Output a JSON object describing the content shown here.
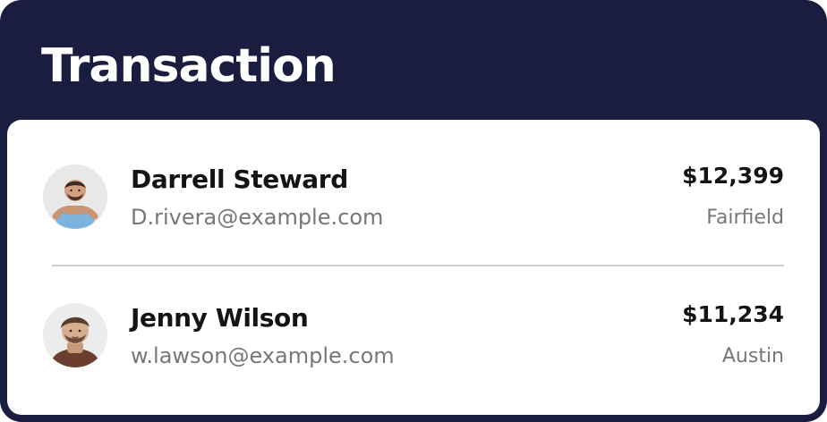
{
  "header": {
    "title": "Transaction"
  },
  "transactions": [
    {
      "name": "Darrell Steward",
      "email": "D.rivera@example.com",
      "amount": "$12,399",
      "location": "Fairfield",
      "avatar_icon": "person-blue-shirt-avatar"
    },
    {
      "name": "Jenny Wilson",
      "email": "w.lawson@example.com",
      "amount": "$11,234",
      "location": "Austin",
      "avatar_icon": "person-dark-shirt-avatar"
    }
  ],
  "colors": {
    "background": "#1a1d3f",
    "card": "#ffffff",
    "primary_text": "#141414",
    "secondary_text": "#777777",
    "divider": "#cfcfcf"
  }
}
